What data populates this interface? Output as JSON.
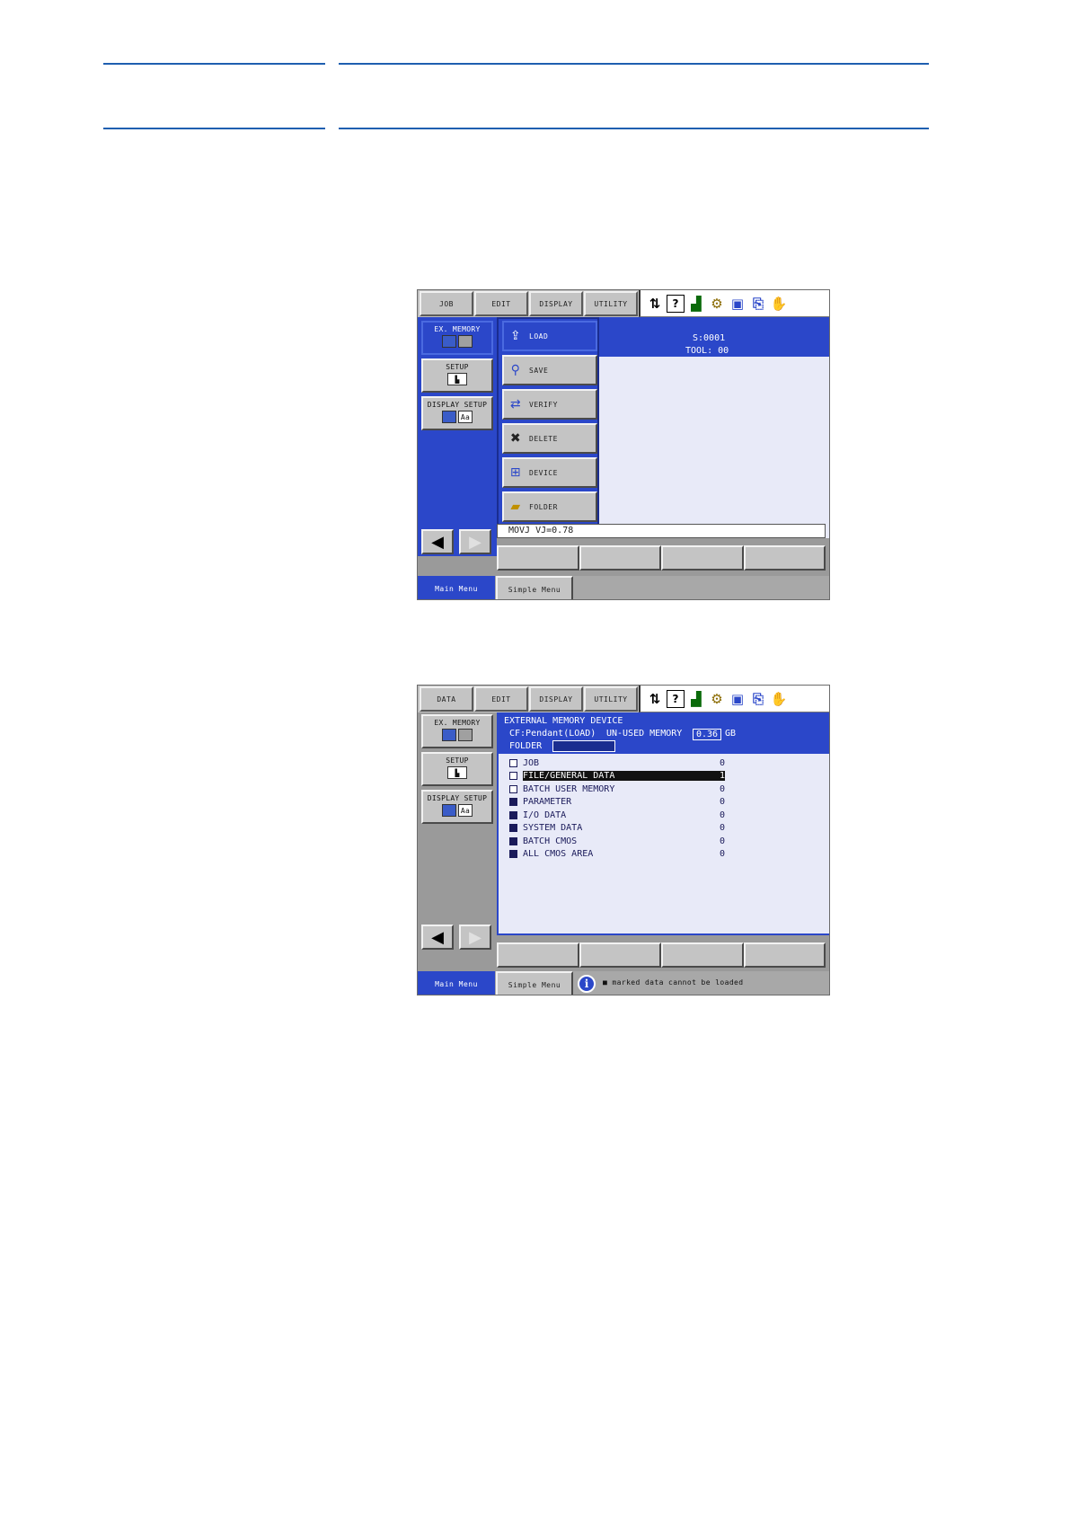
{
  "screen1": {
    "menu_tabs": [
      "JOB",
      "EDIT",
      "DISPLAY",
      "UTILITY"
    ],
    "side_buttons": [
      "EX. MEMORY",
      "SETUP",
      "DISPLAY SETUP"
    ],
    "status_line1": "S:0001",
    "status_line2": "TOOL: 00",
    "dropdown": [
      "LOAD",
      "SAVE",
      "VERIFY",
      "DELETE",
      "DEVICE",
      "FOLDER"
    ],
    "input_line": "MOVJ VJ=0.78",
    "bottom_tabs": [
      "Main Menu",
      "Simple Menu"
    ]
  },
  "screen2": {
    "menu_tabs": [
      "DATA",
      "EDIT",
      "DISPLAY",
      "UTILITY"
    ],
    "side_buttons": [
      "EX. MEMORY",
      "SETUP",
      "DISPLAY SETUP"
    ],
    "header": {
      "title": "EXTERNAL MEMORY DEVICE",
      "device": "CF:Pendant(LOAD)",
      "unused_label": "UN-USED MEMORY",
      "unused_value": "0.36",
      "unused_unit": "GB",
      "folder_label": "FOLDER"
    },
    "items": [
      {
        "label": "JOB",
        "count": "0",
        "marked": false
      },
      {
        "label": "FILE/GENERAL DATA",
        "count": "1",
        "marked": false
      },
      {
        "label": "BATCH USER MEMORY",
        "count": "0",
        "marked": false
      },
      {
        "label": "PARAMETER",
        "count": "0",
        "marked": true
      },
      {
        "label": "I/O DATA",
        "count": "0",
        "marked": true
      },
      {
        "label": "SYSTEM DATA",
        "count": "0",
        "marked": true
      },
      {
        "label": "BATCH CMOS",
        "count": "0",
        "marked": true
      },
      {
        "label": "ALL CMOS AREA",
        "count": "0",
        "marked": true
      }
    ],
    "bottom_tabs": [
      "Main Menu",
      "Simple Menu"
    ],
    "message": "■ marked data cannot be loaded"
  },
  "colors": {
    "accent_blue": "#2b47c9",
    "rule_blue": "#1f5fb0",
    "panel_gray": "#c4c4c4"
  }
}
